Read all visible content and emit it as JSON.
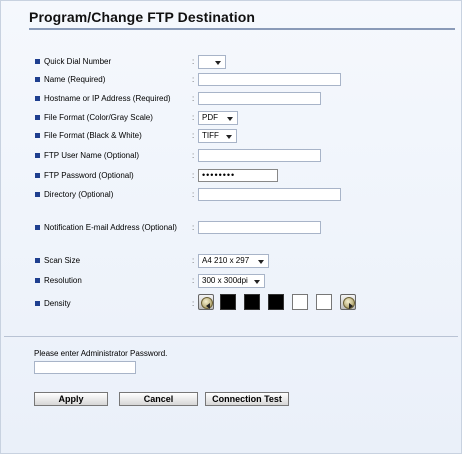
{
  "title": "Program/Change FTP Destination",
  "fields": {
    "quick_dial": {
      "label": "Quick Dial Number",
      "value": ""
    },
    "name": {
      "label": "Name (Required)",
      "value": ""
    },
    "hostname": {
      "label": "Hostname or IP Address (Required)",
      "value": ""
    },
    "file_format_color": {
      "label": "File Format (Color/Gray Scale)",
      "value": "PDF"
    },
    "file_format_bw": {
      "label": "File Format (Black & White)",
      "value": "TIFF"
    },
    "ftp_user": {
      "label": "FTP User Name (Optional)",
      "value": ""
    },
    "ftp_password": {
      "label": "FTP Password (Optional)",
      "value": "••••••••"
    },
    "directory": {
      "label": "Directory (Optional)",
      "value": ""
    },
    "notification_email": {
      "label": "Notification E-mail Address (Optional)",
      "value": ""
    },
    "scan_size": {
      "label": "Scan Size",
      "value": "A4 210 x 297"
    },
    "resolution": {
      "label": "Resolution",
      "value": "300 x 300dpi"
    },
    "density": {
      "label": "Density",
      "level": 3,
      "max": 5
    }
  },
  "colon": ":",
  "admin": {
    "label": "Please enter Administrator Password.",
    "value": ""
  },
  "buttons": {
    "apply": "Apply",
    "cancel": "Cancel",
    "connection_test": "Connection Test"
  },
  "colors": {
    "bullet": "#1f3f8f",
    "rule": "#8a9bb8",
    "panel_bg": "#eaf0f9"
  }
}
